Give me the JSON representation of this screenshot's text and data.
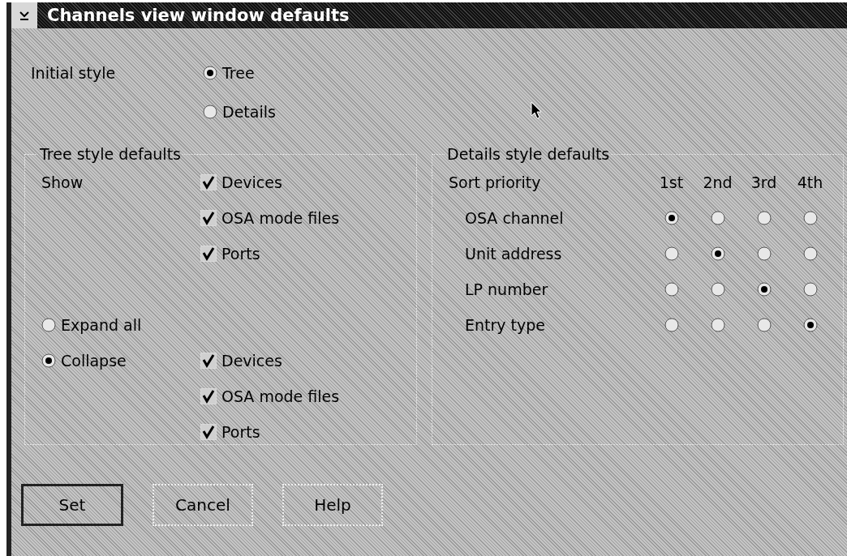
{
  "window": {
    "title": "Channels view window defaults"
  },
  "initial_style": {
    "label": "Initial style",
    "options": [
      {
        "label": "Tree",
        "selected": true
      },
      {
        "label": "Details",
        "selected": false
      }
    ]
  },
  "tree_defaults": {
    "title": "Tree style defaults",
    "show_label": "Show",
    "show_items": [
      {
        "label": "Devices",
        "checked": true
      },
      {
        "label": "OSA mode files",
        "checked": true
      },
      {
        "label": "Ports",
        "checked": true
      }
    ],
    "modes": [
      {
        "label": "Expand all",
        "selected": false
      },
      {
        "label": "Collapse",
        "selected": true
      }
    ],
    "collapse_items": [
      {
        "label": "Devices",
        "checked": true
      },
      {
        "label": "OSA mode files",
        "checked": true
      },
      {
        "label": "Ports",
        "checked": true
      }
    ]
  },
  "details_defaults": {
    "title": "Details style defaults",
    "header": "Sort priority",
    "columns": [
      "1st",
      "2nd",
      "3rd",
      "4th"
    ],
    "rows": [
      {
        "label": "OSA channel",
        "priority": [
          {
            "selected": true
          },
          {
            "selected": false
          },
          {
            "selected": false
          },
          {
            "selected": false
          }
        ]
      },
      {
        "label": "Unit address",
        "priority": [
          {
            "selected": false
          },
          {
            "selected": true
          },
          {
            "selected": false
          },
          {
            "selected": false
          }
        ]
      },
      {
        "label": "LP number",
        "priority": [
          {
            "selected": false
          },
          {
            "selected": false
          },
          {
            "selected": true
          },
          {
            "selected": false
          }
        ]
      },
      {
        "label": "Entry type",
        "priority": [
          {
            "selected": false
          },
          {
            "selected": false
          },
          {
            "selected": false
          },
          {
            "selected": true
          }
        ]
      }
    ]
  },
  "buttons": [
    {
      "label": "Set",
      "default": true
    },
    {
      "label": "Cancel",
      "default": false
    },
    {
      "label": "Help",
      "default": false
    }
  ]
}
